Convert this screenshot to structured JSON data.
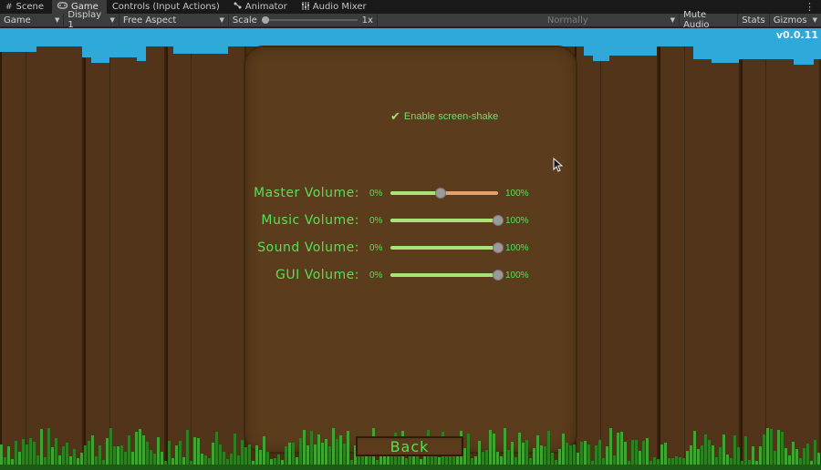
{
  "tabs": [
    {
      "label": "Scene",
      "icon": "hash-grid-icon",
      "active": false
    },
    {
      "label": "Game",
      "icon": "gamepad-icon",
      "active": true
    },
    {
      "label": "Controls (Input Actions)",
      "icon": "",
      "active": false
    },
    {
      "label": "Animator",
      "icon": "animator-icon",
      "active": false
    },
    {
      "label": "Audio Mixer",
      "icon": "audio-mixer-icon",
      "active": false
    }
  ],
  "toolbar": {
    "view_mode": "Game",
    "display": "Display 1",
    "aspect": "Free Aspect",
    "scale_label": "Scale",
    "scale_value": "1x",
    "play_mode": "Normally",
    "mute_audio": "Mute Audio",
    "stats": "Stats",
    "gizmos": "Gizmos"
  },
  "game": {
    "version": "v0.0.11",
    "screen_shake_label": "Enable screen-shake",
    "screen_shake_enabled": true,
    "volumes": [
      {
        "label": "Master Volume:",
        "min": "0%",
        "max": "100%",
        "level": 0.47
      },
      {
        "label": "Music Volume:",
        "min": "0%",
        "max": "100%",
        "level": 1.0
      },
      {
        "label": "Sound Volume:",
        "min": "0%",
        "max": "100%",
        "level": 1.0
      },
      {
        "label": "GUI Volume:",
        "min": "0%",
        "max": "100%",
        "level": 1.0
      }
    ],
    "back_label": "Back"
  },
  "colors": {
    "sky": "#2ea9d9",
    "panel": "#5b3c1c",
    "text_green": "#55e055",
    "slider_fill": "#a7e476",
    "slider_empty": "#e7a06c"
  }
}
